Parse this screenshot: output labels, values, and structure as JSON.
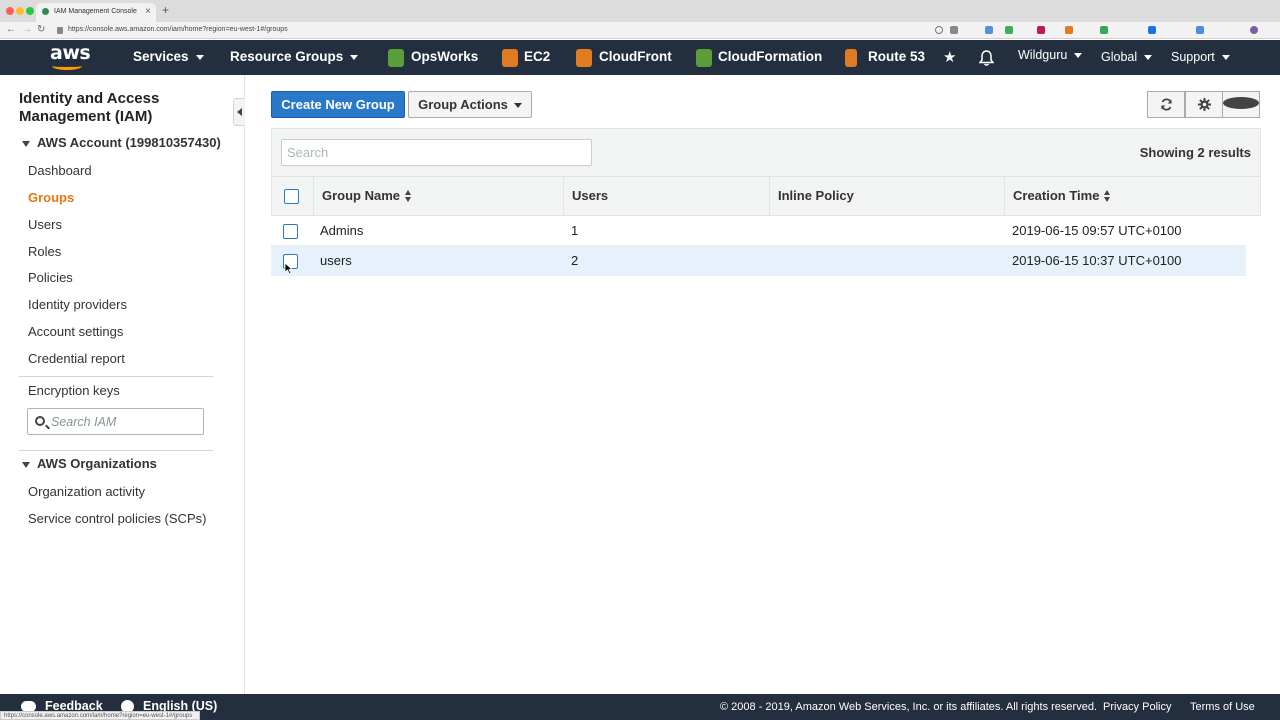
{
  "browser": {
    "tab_title": "IAM Management Console",
    "tab_close": "×",
    "new_tab": "+",
    "url": "https://console.aws.amazon.com/iam/home?region=eu-west-1#/groups",
    "status_url": "https://console.aws.amazon.com/iam/home?region=eu-west-1#/groups"
  },
  "topnav": {
    "logo": "aws",
    "services": "Services",
    "resource_groups": "Resource Groups",
    "shortcuts": [
      {
        "label": "OpsWorks",
        "icon": "opsworks-icon",
        "color": "#5a9e3a"
      },
      {
        "label": "EC2",
        "icon": "ec2-icon",
        "color": "#e07b24"
      },
      {
        "label": "CloudFront",
        "icon": "cloudfront-icon",
        "color": "#e07b24"
      },
      {
        "label": "CloudFormation",
        "icon": "cloudformation-icon",
        "color": "#5a9e3a"
      },
      {
        "label": "Route 53",
        "icon": "route53-icon",
        "color": "#e07b24"
      }
    ],
    "user": "Wildguru",
    "region": "Global",
    "support": "Support"
  },
  "sidebar": {
    "title": "Identity and Access Management (IAM)",
    "account_section": "AWS Account (199810357430)",
    "items": [
      {
        "label": "Dashboard",
        "active": false
      },
      {
        "label": "Groups",
        "active": true
      },
      {
        "label": "Users",
        "active": false
      },
      {
        "label": "Roles",
        "active": false
      },
      {
        "label": "Policies",
        "active": false
      },
      {
        "label": "Identity providers",
        "active": false
      },
      {
        "label": "Account settings",
        "active": false
      },
      {
        "label": "Credential report",
        "active": false
      }
    ],
    "encryption_keys": "Encryption keys",
    "search_placeholder": "Search IAM",
    "org_section": "AWS Organizations",
    "org_items": [
      {
        "label": "Organization activity"
      },
      {
        "label": "Service control policies (SCPs)"
      }
    ]
  },
  "toolbar": {
    "create_group": "Create New Group",
    "group_actions": "Group Actions",
    "help_glyph": "?"
  },
  "filter": {
    "search_placeholder": "Search",
    "results": "Showing 2 results"
  },
  "table": {
    "columns": [
      "Group Name",
      "Users",
      "Inline Policy",
      "Creation Time"
    ],
    "rows": [
      {
        "name": "Admins",
        "users": "1",
        "inline_policy": "",
        "created": "2019-06-15 09:57 UTC+0100"
      },
      {
        "name": "users",
        "users": "2",
        "inline_policy": "",
        "created": "2019-06-15 10:37 UTC+0100"
      }
    ]
  },
  "footer": {
    "feedback": "Feedback",
    "language": "English (US)",
    "copyright": "© 2008 - 2019, Amazon Web Services, Inc. or its affiliates. All rights reserved.",
    "privacy": "Privacy Policy",
    "terms": "Terms of Use"
  },
  "colors": {
    "nav_bg": "#232f3e",
    "primary": "#2a78c9",
    "active_link": "#e47911",
    "selected_row": "#e6f1fb"
  }
}
